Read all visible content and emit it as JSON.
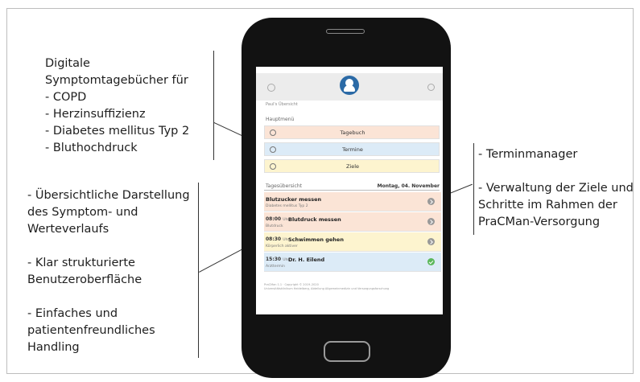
{
  "callouts": {
    "left_top": [
      "Digitale",
      "Symptomtagebücher für",
      "- COPD",
      "- Herzinsuffizienz",
      "- Diabetes mellitus Typ 2",
      "- Bluthochdruck"
    ],
    "left_bottom_1": [
      "- Übersichtliche Darstellung",
      "des Symptom- und",
      "Werteverlaufs"
    ],
    "left_bottom_2": [
      "- Klar strukturierte",
      "Benutzeroberfläche"
    ],
    "left_bottom_3": [
      "- Einfaches und",
      "patientenfreundliches",
      "Handling"
    ],
    "right_1": [
      "- Terminmanager"
    ],
    "right_2": [
      "- Verwaltung der Ziele und",
      "Schritte im Rahmen der",
      "PraCMan-Versorgung"
    ]
  },
  "screen": {
    "breadcrumb": "Paul's Übersicht",
    "main_menu_label": "Hauptmenü",
    "menu": [
      {
        "label": "Tagebuch",
        "color": "#fbe4d6",
        "icon": "clock-icon"
      },
      {
        "label": "Termine",
        "color": "#dcebf7",
        "icon": "calendar-icon"
      },
      {
        "label": "Ziele",
        "color": "#fdf4cf",
        "icon": "target-icon"
      }
    ],
    "overview_label": "Tagesübersicht",
    "date": "Montag, 04. November",
    "tasks": [
      {
        "time": "",
        "uhr": "",
        "title": "Blutzucker messen",
        "subtitle": "Diabetes mellitus Typ 2",
        "color": "#fbe4d6",
        "status": "arrow"
      },
      {
        "time": "08:00",
        "uhr": "Uhr",
        "title": "Blutdruck messen",
        "subtitle": "Blutdruck",
        "color": "#fbe4d6",
        "status": "arrow"
      },
      {
        "time": "08:30",
        "uhr": "Uhr",
        "title": "Schwimmen gehen",
        "subtitle": "Körperlich aktiver",
        "color": "#fdf4cf",
        "status": "arrow"
      },
      {
        "time": "15:30",
        "uhr": "Uhr",
        "title": "Dr. H. Eilend",
        "subtitle": "Arzttermin",
        "color": "#dcebf7",
        "status": "check"
      }
    ],
    "footer": [
      "PraCMan 1.1 · Copyright © 2019–2020",
      "Universitätsklinikum Heidelberg, Abteilung Allgemeinmedizin und Versorgungsforschung"
    ]
  }
}
